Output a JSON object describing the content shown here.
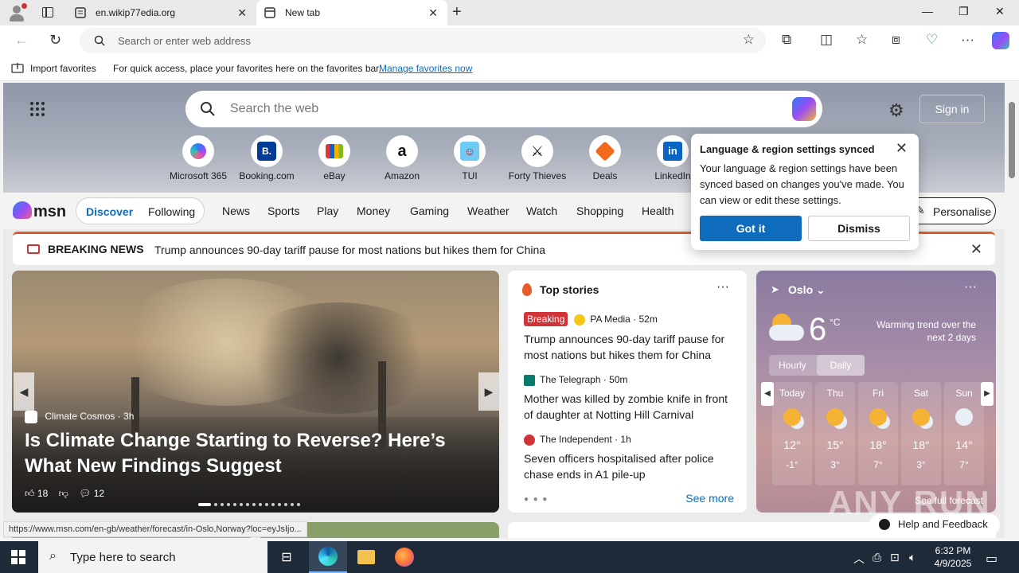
{
  "browser": {
    "tabs": [
      {
        "label": "en.wikip77edia.org",
        "active": false
      },
      {
        "label": "New tab",
        "active": true
      }
    ],
    "address_placeholder": "Search or enter web address",
    "favorites": {
      "import_label": "Import favorites",
      "hint": "For quick access, place your favorites here on the favorites bar.",
      "manage_link": "Manage favorites now"
    },
    "status_url": "https://www.msn.com/en-gb/weather/forecast/in-Oslo,Norway?loc=eyJsIjo..."
  },
  "newtab": {
    "search_placeholder": "Search the web",
    "signin_label": "Sign in",
    "quick_links": [
      {
        "label": "Microsoft 365",
        "icon": "microsoft-365-icon",
        "color": "#7b5cf5"
      },
      {
        "label": "Booking.com",
        "icon": "booking-icon",
        "glyph": "B.",
        "color": "#003b95"
      },
      {
        "label": "eBay",
        "icon": "ebay-icon",
        "color": "#e53238"
      },
      {
        "label": "Amazon",
        "icon": "amazon-icon",
        "glyph": "a",
        "color": "#111111"
      },
      {
        "label": "TUI",
        "icon": "tui-icon",
        "color": "#d40e14"
      },
      {
        "label": "Forty Thieves",
        "icon": "forty-thieves-icon",
        "color": "#111111"
      },
      {
        "label": "Deals",
        "icon": "deals-icon",
        "color": "#f2691c"
      },
      {
        "label": "LinkedIn",
        "icon": "linkedin-icon",
        "glyph": "in",
        "color": "#0a66c2"
      }
    ]
  },
  "msn": {
    "logo": "msn",
    "feed_tabs": [
      "Discover",
      "Following"
    ],
    "nav": [
      "News",
      "Sports",
      "Play",
      "Money",
      "Gaming",
      "Weather",
      "Watch",
      "Shopping",
      "Health"
    ],
    "personalise_label": "Personalise",
    "breaking": {
      "label": "BREAKING NEWS",
      "text": "Trump announces 90-day tariff pause for most nations but hikes them for China"
    },
    "main_story": {
      "source": "Climate Cosmos",
      "age": "3h",
      "headline": "Is Climate Change Starting to Reverse? Here’s What New Findings Suggest",
      "likes": "18",
      "comments": "12"
    },
    "top_stories": {
      "title": "Top stories",
      "items": [
        {
          "badge": "Breaking",
          "source": "PA Media · 52m",
          "title": "Trump announces 90-day tariff pause for most nations but hikes them for China"
        },
        {
          "source": "The Telegraph · 50m",
          "title": "Mother was killed by zombie knife in front of daughter at Notting Hill Carnival"
        },
        {
          "source": "The Independent · 1h",
          "title": "Seven officers hospitalised after police chase ends in A1 pile-up"
        }
      ],
      "see_more": "See more"
    },
    "weather": {
      "location": "Oslo",
      "temp": "6",
      "unit": "°C",
      "trend": "Warming trend over the next 2 days",
      "tabs": [
        "Hourly",
        "Daily"
      ],
      "days": [
        {
          "day": "Today",
          "hi": "12°",
          "lo": "-1°"
        },
        {
          "day": "Thu",
          "hi": "15°",
          "lo": "3°"
        },
        {
          "day": "Fri",
          "hi": "18°",
          "lo": "7°"
        },
        {
          "day": "Sat",
          "hi": "18°",
          "lo": "3°"
        },
        {
          "day": "Sun",
          "hi": "14°",
          "lo": "7°"
        }
      ],
      "footer": "See full forecast"
    },
    "popup": {
      "title": "Language & region settings synced",
      "body": "Your language & region settings have been synced based on changes you've made. You can view or edit these settings.",
      "primary": "Got it",
      "secondary": "Dismiss"
    },
    "help_label": "Help and Feedback"
  },
  "taskbar": {
    "search_placeholder": "Type here to search",
    "time": "6:32 PM",
    "date": "4/9/2025"
  },
  "watermark": "ANY RUN"
}
